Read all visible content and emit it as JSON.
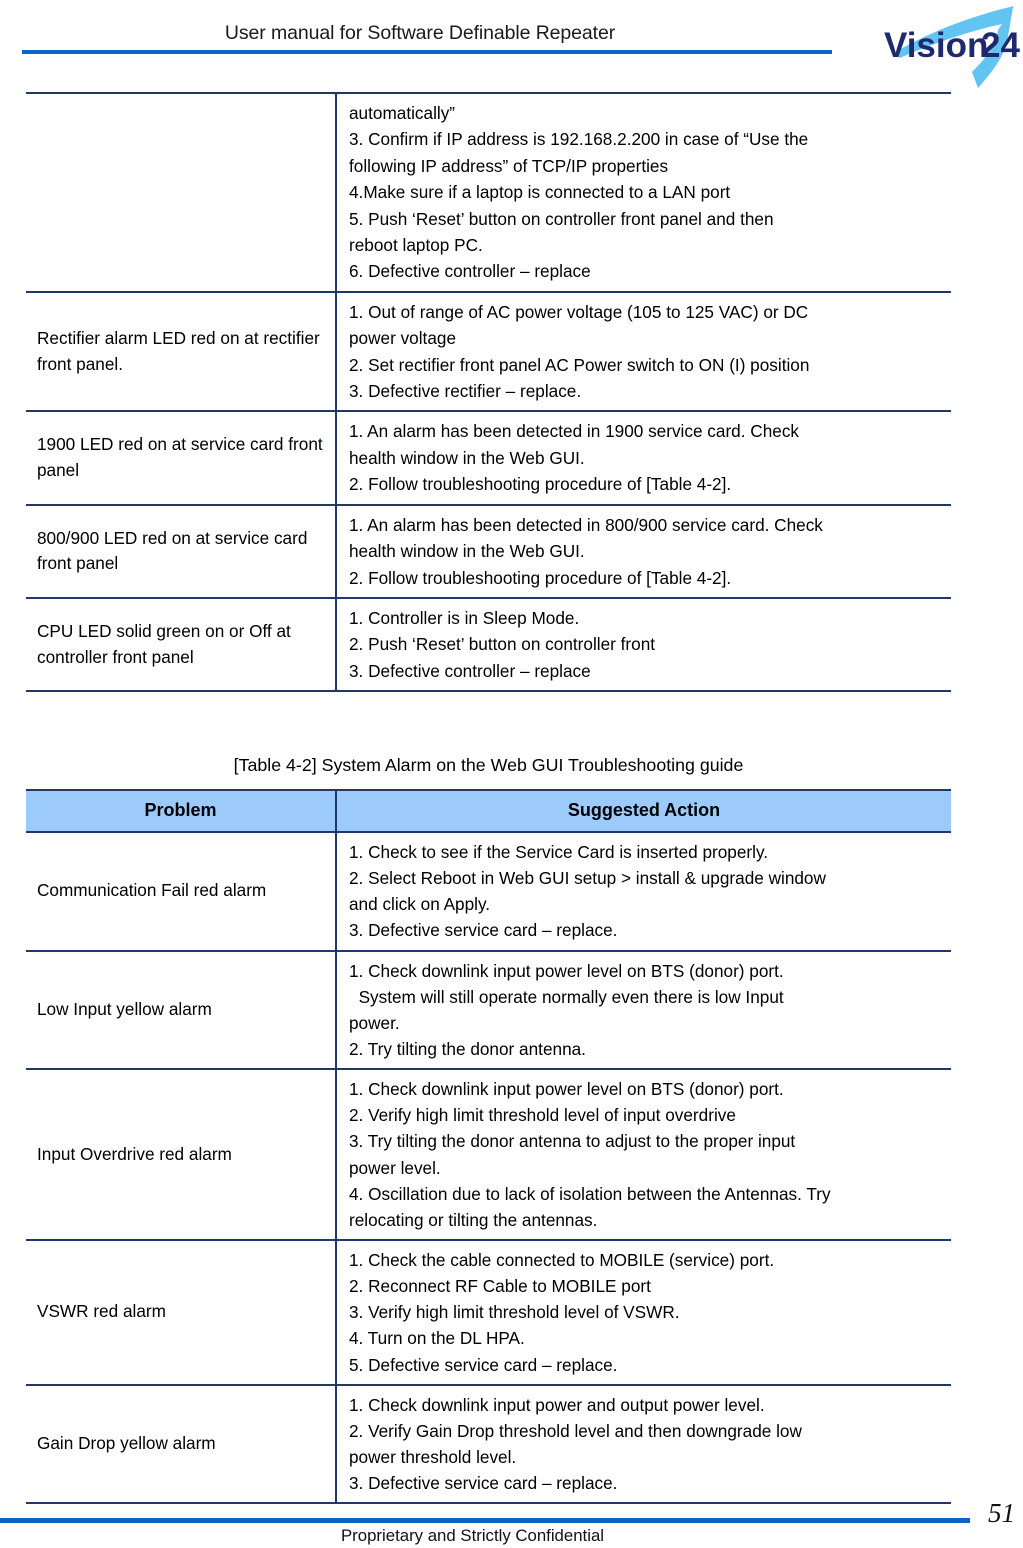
{
  "header": {
    "title": "User manual for Software Definable Repeater",
    "logo_text": "Vision24",
    "logo_swoosh_color": "#62C4F2",
    "logo_word_color": "#1F2A6E",
    "rule_color": "#0A66C2"
  },
  "table_system_led": {
    "rows": [
      {
        "problem": "",
        "actions": [
          "automatically”",
          "3. Confirm if IP address is 192.168.2.200 in case of “Use the",
          "following IP address” of TCP/IP properties",
          "4.Make sure if a laptop is connected to a LAN port",
          "5. Push ‘Reset’ button on controller front panel and then",
          "reboot laptop PC.",
          "6. Defective controller – replace"
        ]
      },
      {
        "problem": "Rectifier alarm LED red on at rectifier front panel.",
        "actions": [
          "1. Out of range of AC power voltage (105 to 125 VAC) or DC",
          "power voltage",
          "2. Set rectifier front panel AC Power switch to ON (I) position",
          "3. Defective rectifier – replace."
        ]
      },
      {
        "problem": "1900 LED red on at service card front panel",
        "actions": [
          "1. An alarm has been detected in 1900 service card. Check",
          "health window in the Web GUI.",
          "2. Follow troubleshooting procedure of [Table 4-2]."
        ]
      },
      {
        "problem": "800/900 LED red on at service card front panel",
        "actions": [
          "1. An alarm has been detected in 800/900 service card. Check",
          "health window in the Web GUI.",
          "2. Follow troubleshooting procedure of [Table 4-2]."
        ]
      },
      {
        "problem": "CPU LED solid green on or Off at controller front panel",
        "actions": [
          "1. Controller is in Sleep Mode.",
          "2. Push ‘Reset’ button on controller front",
          "3. Defective controller – replace"
        ]
      }
    ]
  },
  "table_web_gui_alarm": {
    "caption": "[Table 4-2] System Alarm on the Web GUI Troubleshooting guide",
    "header_bg": "#9CCBFB",
    "columns": [
      "Problem",
      "Suggested Action"
    ],
    "rows": [
      {
        "problem": "Communication Fail red alarm",
        "actions": [
          "1. Check to see if the Service Card is inserted properly.",
          "2. Select Reboot in Web GUI setup > install & upgrade window",
          "and click on Apply.",
          "3. Defective service card – replace."
        ]
      },
      {
        "problem": "Low Input yellow alarm",
        "actions": [
          "1. Check downlink input power level on BTS (donor) port.",
          "  System will still operate normally even there is low Input",
          "power.",
          "2. Try tilting the donor antenna."
        ]
      },
      {
        "problem": "Input Overdrive red alarm",
        "actions": [
          "1. Check downlink input power level on BTS (donor) port.",
          "2. Verify high limit threshold level of input overdrive",
          "3. Try tilting the donor antenna to adjust to the proper input",
          "power level.",
          "4. Oscillation due to lack of isolation between the Antennas. Try",
          "relocating or tilting the antennas."
        ],
        "justified_lines": [
          2
        ]
      },
      {
        "problem": "VSWR red alarm",
        "actions": [
          "1. Check the cable connected to MOBILE (service) port.",
          "2. Reconnect RF Cable to MOBILE port",
          "3. Verify high limit threshold level of VSWR.",
          "4. Turn on the DL HPA.",
          "5. Defective service card – replace."
        ]
      },
      {
        "problem": "Gain Drop yellow alarm",
        "actions": [
          "1. Check downlink input power and output power level.",
          "2. Verify Gain Drop threshold level and then downgrade low",
          "power threshold level.",
          "3. Defective service card – replace."
        ]
      }
    ]
  },
  "footer": {
    "text": "Proprietary and Strictly Confidential",
    "page_number": "51",
    "rule_color": "#0A66C2"
  }
}
